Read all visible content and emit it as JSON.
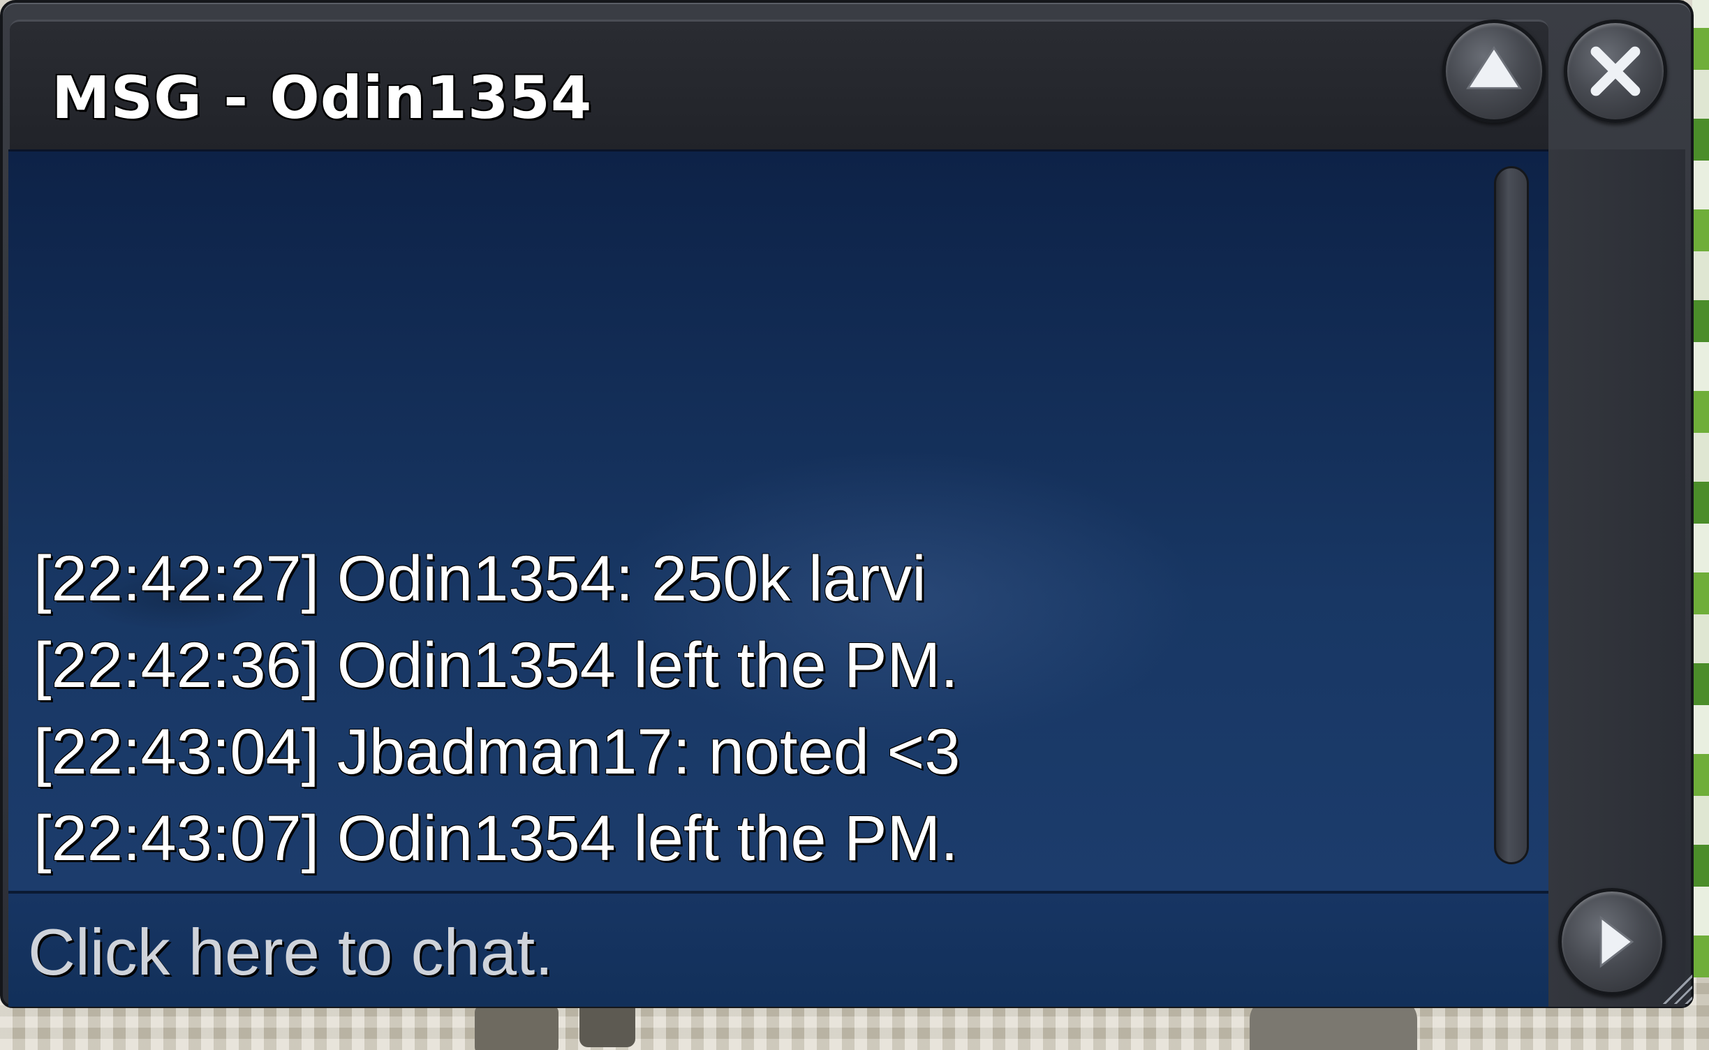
{
  "window": {
    "title": "MSG - Odin1354"
  },
  "buttons": {
    "minimize_icon": "triangle-up-icon",
    "close_icon": "close-x-icon",
    "send_icon": "triangle-right-icon"
  },
  "messages": [
    "[22:42:27] Odin1354: 250k larvi",
    "[22:42:36] Odin1354 left the PM.",
    "[22:43:04] Jbadman17: noted <3",
    "[22:43:07] Odin1354 left the PM."
  ],
  "input": {
    "placeholder": "Click here to chat."
  },
  "colors": {
    "panel_bg": "#183764",
    "frame": "#2c2f36",
    "text": "#ffffff"
  }
}
